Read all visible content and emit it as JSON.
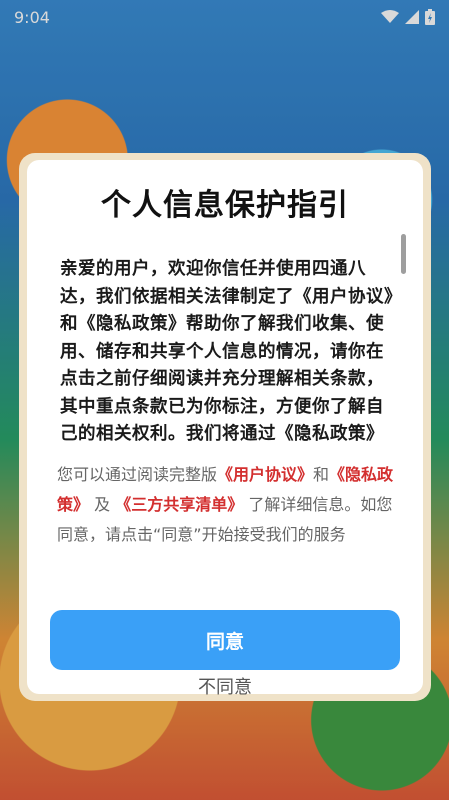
{
  "status_bar": {
    "time": "9:04"
  },
  "dialog": {
    "title": "个人信息保护指引",
    "body": "亲爱的用户，欢迎你信任并使用四通八达，我们依据相关法律制定了《用户协议》和《隐私政策》帮助你了解我们收集、使用、储存和共享个人信息的情况，请你在点击之前仔细阅读并充分理解相关条款，其中重点条款已为你标注，方便你了解自己的相关权利。我们将通过《隐私政策》向你",
    "notice": {
      "prefix": "您可以通过阅读完整版",
      "link_user_agreement": "《用户协议》",
      "and": "和",
      "link_privacy_policy": "《隐私政策》",
      "mid": "及",
      "link_third_party": "《三方共享清单》",
      "suffix": "了解详细信息。如您同意，请点击“同意”开始接受我们的服务"
    },
    "agree_label": "同意",
    "disagree_label": "不同意"
  },
  "colors": {
    "accent": "#3aa0f7",
    "link": "#d32f2f"
  }
}
